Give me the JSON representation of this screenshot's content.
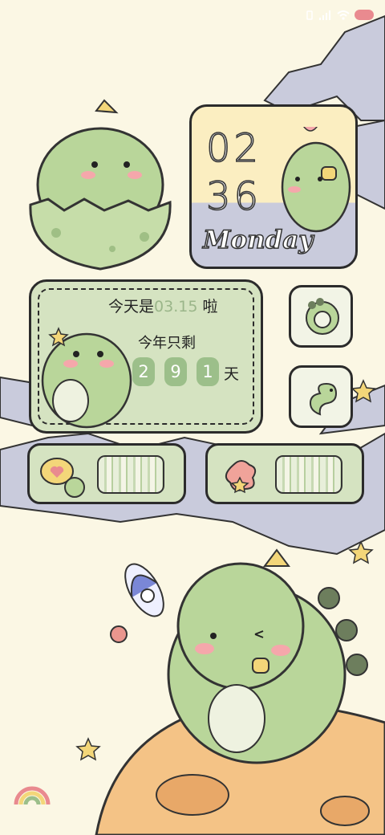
{
  "status_bar": {
    "icons": [
      "vibrate-icon",
      "signal-icon",
      "wifi-icon",
      "battery-icon"
    ],
    "battery_color": "#e98a8f"
  },
  "clock_widget": {
    "hour": "02",
    "minute": "36",
    "weekday": "Monday"
  },
  "countdown_widget": {
    "prefix": "今天是",
    "date": "03.15",
    "suffix": "啦",
    "remaining_label": "今年只剩",
    "digits": [
      "2",
      "9",
      "1"
    ],
    "unit": "天"
  },
  "app_icons": [
    "dinosaur-face-icon",
    "dinosaur-body-icon",
    "heart-bubble-icon",
    "flower-icon"
  ],
  "colors": {
    "background": "#fbf7e4",
    "dino_green": "#b9d69a",
    "card_green": "#d5e3c1",
    "digit_green": "#9cbf8a",
    "cloud_gray": "#c5c8d9",
    "moon_orange": "#f4c386"
  }
}
